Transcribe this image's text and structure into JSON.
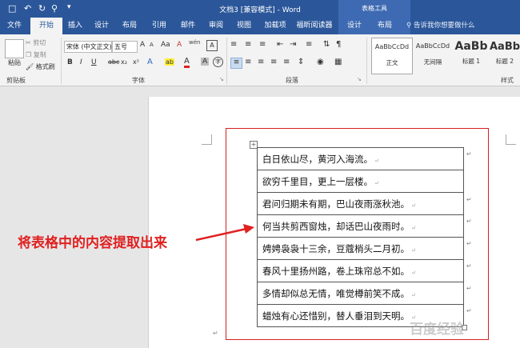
{
  "window": {
    "title": "文档3 [兼容模式] - Word",
    "context_tab_group": "表格工具"
  },
  "tabs": [
    "文件",
    "开始",
    "插入",
    "设计",
    "布局",
    "引用",
    "邮件",
    "审阅",
    "视图",
    "加载项",
    "福昕阅读器",
    "设计",
    "布局"
  ],
  "active_tab": "开始",
  "tell_me": "告诉我你想要做什么",
  "clipboard": {
    "paste": "粘贴",
    "cut": "剪切",
    "copy": "复制",
    "format_painter": "格式刷",
    "label": "剪贴板"
  },
  "font": {
    "name": "宋体 (中文正文)",
    "size": "五号",
    "label": "字体",
    "bold": "B",
    "italic": "I",
    "underline": "U",
    "strike": "abc",
    "subscript": "x₂",
    "superscript": "x²",
    "grow": "A",
    "shrink": "A",
    "case": "Aa",
    "clear": "A",
    "phonetic": "wén",
    "border": "A",
    "effects": "A",
    "highlight": "ab",
    "font_color": "A",
    "shading": "A",
    "enclose": "字"
  },
  "paragraph": {
    "label": "段落"
  },
  "styles": {
    "label": "样式",
    "items": [
      {
        "sample": "AaBbCcDd",
        "name": "正文"
      },
      {
        "sample": "AaBbCcDd",
        "name": "无间隔"
      },
      {
        "sample": "AaBb",
        "name": "标题 1"
      },
      {
        "sample": "AaBb",
        "name": "标题 2"
      }
    ]
  },
  "poem_rows": [
    "白日依山尽，黄河入海流。",
    "欲穷千里目，更上一层楼。",
    "君问归期未有期，巴山夜雨涨秋池。",
    "何当共剪西窗烛，却话巴山夜雨时。",
    "娉娉袅袅十三余，豆蔻梢头二月初。",
    "春风十里扬州路，卷上珠帘总不如。",
    "多情却似总无情，唯觉樽前笑不成。",
    "蜡烛有心还惜别，替人垂泪到天明。"
  ],
  "annotation": "将表格中的内容提取出来",
  "watermark": "百度经验",
  "colors": {
    "title_bar": "#2b579a",
    "annotation": "#e02020",
    "highlight_box": "#d51f1f"
  }
}
